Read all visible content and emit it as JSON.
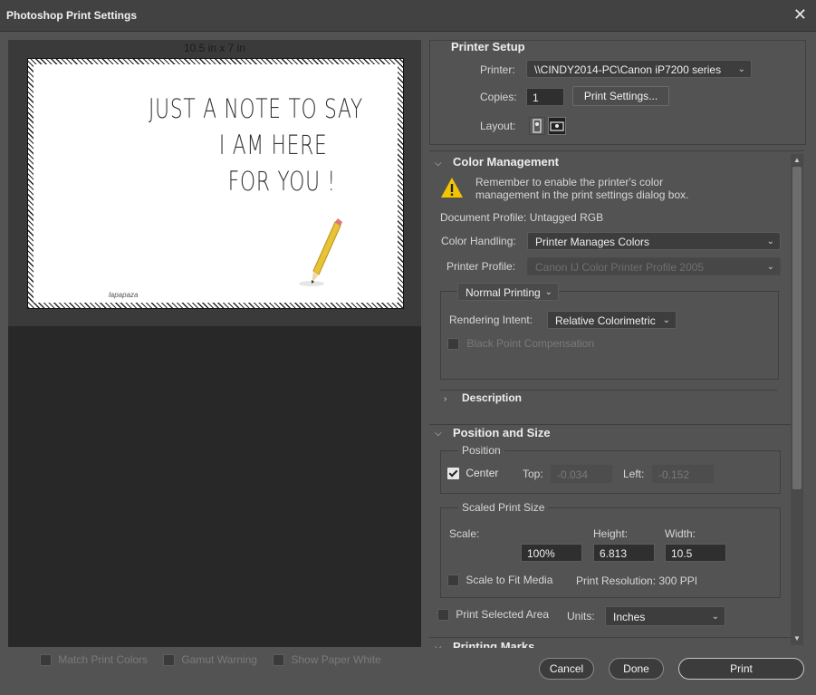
{
  "window": {
    "title": "Photoshop Print Settings",
    "close_glyph": "✕"
  },
  "preview": {
    "dimensions_label": "10.5 in x 7 in",
    "note_lines": [
      "JUST A NOTE TO SAY",
      "I AM HERE",
      "FOR YOU !"
    ],
    "signature": "lapapaza"
  },
  "bottom_checks": {
    "match_print_colors": "Match Print Colors",
    "gamut_warning": "Gamut Warning",
    "show_paper_white": "Show Paper White"
  },
  "printer_setup": {
    "header": "Printer Setup",
    "printer_label": "Printer:",
    "printer_value": "\\\\CINDY2014-PC\\Canon iP7200 series",
    "copies_label": "Copies:",
    "copies_value": "1",
    "print_settings_button": "Print Settings...",
    "layout_label": "Layout:"
  },
  "color_management": {
    "header": "Color Management",
    "warning_line1": "Remember to enable the printer's color",
    "warning_line2": "management in the print settings dialog box.",
    "document_profile": "Document Profile: Untagged RGB",
    "color_handling_label": "Color Handling:",
    "color_handling_value": "Printer Manages Colors",
    "printer_profile_label": "Printer Profile:",
    "printer_profile_value": "Canon IJ Color Printer Profile 2005",
    "printing_mode": "Normal Printing",
    "rendering_intent_label": "Rendering Intent:",
    "rendering_intent_value": "Relative Colorimetric",
    "black_point": "Black Point Compensation",
    "description": "Description"
  },
  "position_size": {
    "header": "Position and Size",
    "position_group": "Position",
    "center_label": "Center",
    "top_label": "Top:",
    "top_value": "-0.034",
    "left_label": "Left:",
    "left_value": "-0.152",
    "scaled_group": "Scaled Print Size",
    "scale_label": "Scale:",
    "scale_value": "100%",
    "height_label": "Height:",
    "height_value": "6.813",
    "width_label": "Width:",
    "width_value": "10.5",
    "scale_to_fit": "Scale to Fit Media",
    "print_resolution": "Print Resolution: 300 PPI",
    "print_selected_area": "Print Selected Area",
    "units_label": "Units:",
    "units_value": "Inches"
  },
  "printing_marks": {
    "header": "Printing Marks"
  },
  "buttons": {
    "cancel": "Cancel",
    "done": "Done",
    "print": "Print"
  },
  "colors": {
    "background": "#535353",
    "title_bar": "#424242",
    "preview_bg": "#282828"
  }
}
